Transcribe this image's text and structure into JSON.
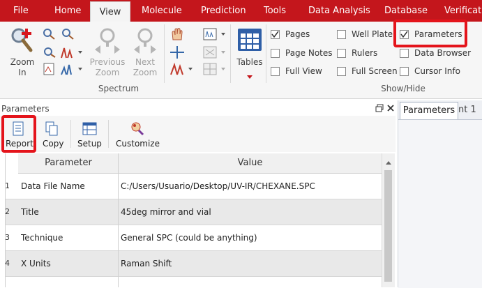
{
  "menu": {
    "items": [
      "File",
      "Home",
      "View",
      "Molecule",
      "Prediction",
      "Tools",
      "Data Analysis",
      "Database",
      "Verificat"
    ]
  },
  "ribbon": {
    "zoom_in_label": "Zoom\nIn",
    "previous_zoom_label": "Previous\nZoom",
    "next_zoom_label": "Next\nZoom",
    "tables_label": "Tables",
    "spectrum_group_label": "Spectrum",
    "showhide_group_label": "Show/Hide",
    "checkboxes": {
      "pages": {
        "label": "Pages",
        "checked": true
      },
      "page_notes": {
        "label": "Page Notes",
        "checked": false
      },
      "full_view": {
        "label": "Full View",
        "checked": false
      },
      "well_plate": {
        "label": "Well Plate",
        "checked": false
      },
      "rulers": {
        "label": "Rulers",
        "checked": false
      },
      "full_screen": {
        "label": "Full Screen",
        "checked": false
      },
      "parameters": {
        "label": "Parameters",
        "checked": true
      },
      "data_browser": {
        "label": "Data Browser",
        "checked": false
      },
      "cursor_info": {
        "label": "Cursor Info",
        "checked": false
      }
    }
  },
  "panel": {
    "title": "Parameters",
    "toolbar": {
      "report": "Report",
      "copy": "Copy",
      "setup": "Setup",
      "customize": "Customize"
    },
    "columns": [
      "Parameter",
      "Value"
    ],
    "rows": [
      {
        "num": "1",
        "param": "Data File Name",
        "value": "C:/Users/Usuario/Desktop/UV-IR/CHEXANE.SPC"
      },
      {
        "num": "2",
        "param": "Title",
        "value": "45deg mirror and vial"
      },
      {
        "num": "3",
        "param": "Technique",
        "value": "General SPC (could be anything)"
      },
      {
        "num": "4",
        "param": "X Units",
        "value": "Raman Shift"
      }
    ]
  },
  "right_pane": {
    "tabs": [
      "Parameters",
      "nt 1"
    ]
  },
  "colors": {
    "menubar": "#c4161c",
    "highlight": "#e4141b"
  }
}
